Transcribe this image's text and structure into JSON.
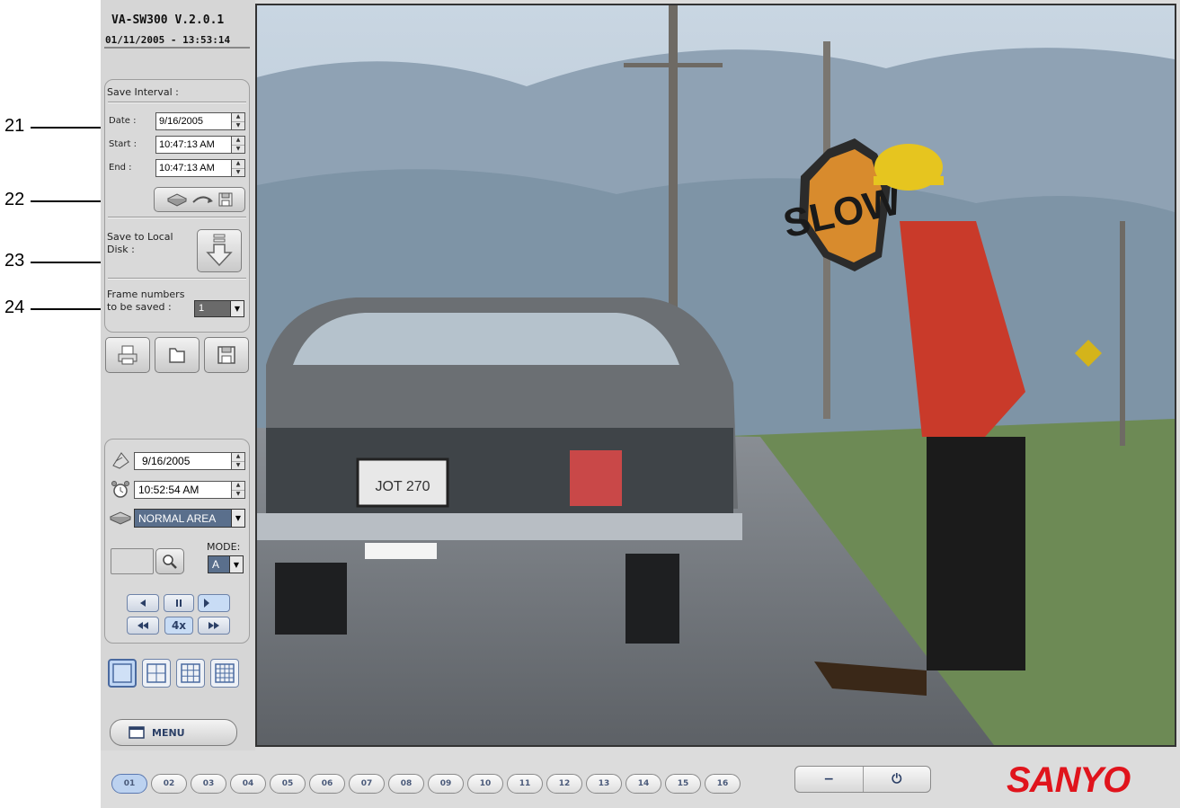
{
  "callouts": [
    {
      "num": "21"
    },
    {
      "num": "22"
    },
    {
      "num": "23"
    },
    {
      "num": "24"
    }
  ],
  "app": {
    "title": "VA-SW300  V.2.0.1",
    "datetime": "01/11/2005 - 13:53:14"
  },
  "save_interval": {
    "heading": "Save Interval :",
    "date_label": "Date :",
    "date_value": "9/16/2005",
    "start_label": "Start :",
    "start_value": "10:47:13 AM",
    "end_label": "End :",
    "end_value": "10:47:13 AM"
  },
  "save_local": {
    "label_line1": "Save to Local",
    "label_line2": "Disk :"
  },
  "frames": {
    "label_line1": "Frame numbers",
    "label_line2": "to be saved :",
    "value": "1"
  },
  "playback": {
    "date_value": "9/16/2005",
    "time_value": "10:52:54 AM",
    "area_value": "NORMAL AREA",
    "mode_label": "MODE:",
    "mode_value": "A",
    "speed": "4x"
  },
  "menu": {
    "label": "MENU"
  },
  "video": {
    "sign_text": "SLOW",
    "plate_text": "JOT 270"
  },
  "channels": [
    "01",
    "02",
    "03",
    "04",
    "05",
    "06",
    "07",
    "08",
    "09",
    "10",
    "11",
    "12",
    "13",
    "14",
    "15",
    "16"
  ],
  "selected_channel": "01",
  "power": {
    "minimize": "−",
    "power": "⏻"
  },
  "brand": {
    "logo": "SANYO"
  },
  "colors": {
    "brand_red": "#e0141c",
    "accent_blue": "#2b3f66"
  }
}
